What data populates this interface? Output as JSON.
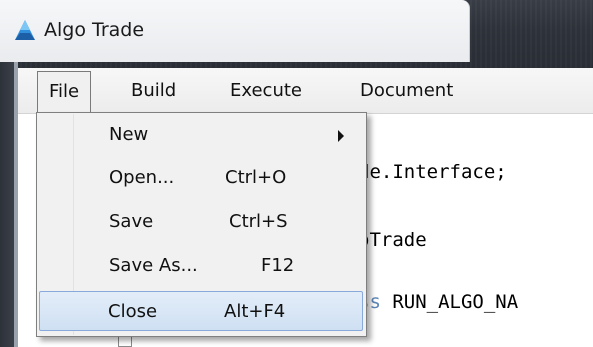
{
  "window": {
    "title": "Algo Trade",
    "logo_icon": "algo-trade-logo-icon"
  },
  "menubar": {
    "items": [
      {
        "label": "File"
      },
      {
        "label": "Build"
      },
      {
        "label": "Execute"
      },
      {
        "label": "Document"
      }
    ]
  },
  "file_menu": {
    "items": [
      {
        "label": "New",
        "shortcut": "",
        "has_submenu": true,
        "submenu_icon": "chevron-right-icon"
      },
      {
        "label": "Open...",
        "shortcut": "Ctrl+O"
      },
      {
        "label": "Save",
        "shortcut": "Ctrl+S"
      },
      {
        "label": "Save As...",
        "shortcut": "F12"
      },
      {
        "label": "Close",
        "shortcut": "Alt+F4",
        "highlighted": true
      }
    ]
  },
  "editor": {
    "lines": [
      {
        "text": "de.Interface;"
      },
      {
        "text": "oTrade"
      },
      {
        "prefix": "ss",
        "text": " RUN_ALGO_NA"
      }
    ]
  },
  "colors": {
    "highlight": "#cfe0f3",
    "highlight_border": "#88aadb",
    "keyword": "#5c86b8"
  }
}
